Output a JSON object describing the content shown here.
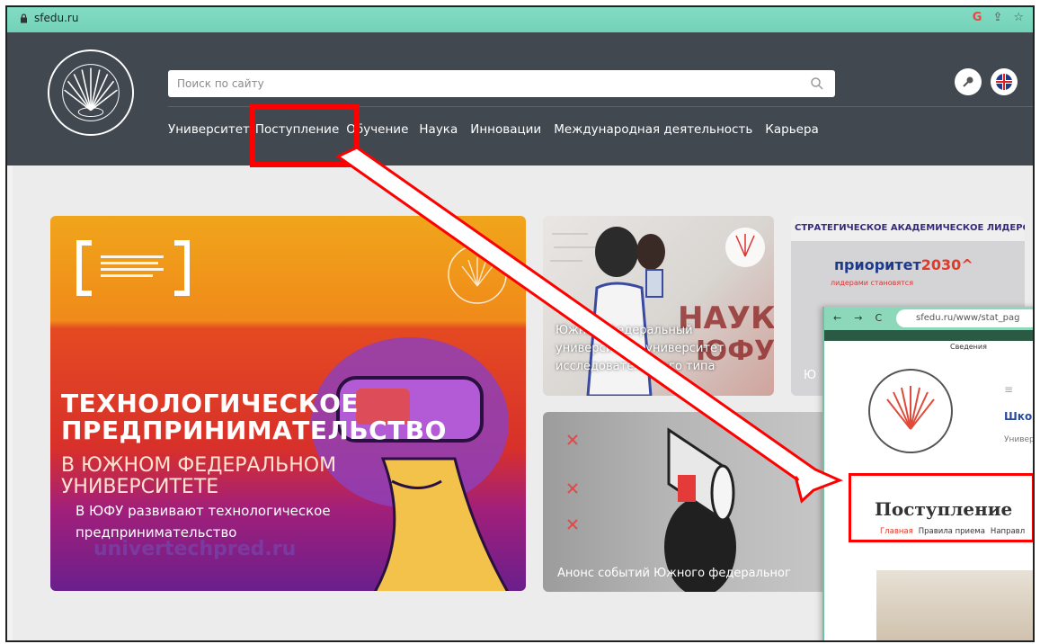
{
  "browser": {
    "url": "sfedu.ru",
    "icons": [
      "google-icon",
      "share-icon",
      "star-icon"
    ]
  },
  "header": {
    "search_placeholder": "Поиск по сайту",
    "nav": [
      "Университет",
      "Поступление",
      "Обучение",
      "Наука",
      "Инновации",
      "Международная деятельность",
      "Карьера"
    ]
  },
  "cards": {
    "big": {
      "headline1": "ТЕХНОЛОГИЧЕСКОЕ",
      "headline2": "ПРЕДПРИНИМАТЕЛЬСТВО",
      "sub1": "В ЮЖНОМ ФЕДЕРАЛЬНОМ",
      "sub2": "УНИВЕРСИТЕТЕ",
      "caption1": "В ЮФУ развивают технологическое",
      "caption2": "предпринимательство",
      "domain": "univertechpred.ru"
    },
    "science": {
      "line1": "Южный федеральный",
      "line2": "университет - университет",
      "line3": "исследовательского типа"
    },
    "priority": {
      "banner": "СТРАТЕГИЧЕСКОЕ АКАДЕМИЧЕСКОЕ ЛИДЕРСТВО",
      "logo_a": "приоритет",
      "logo_b": "2030^",
      "tagline": "лидерами становятся",
      "caption": "Ю"
    },
    "events": {
      "caption": "Анонс событий Южного федеральног"
    }
  },
  "popup": {
    "url": "sfedu.ru/www/stat_pag",
    "info": "Сведения",
    "school": "Школьн",
    "univ": "Универси",
    "title": "Поступление",
    "breadcrumb_home": "Главная",
    "breadcrumb_rules": "Правила приема",
    "breadcrumb_dir": "Направл"
  },
  "colors": {
    "header_bg": "#424850",
    "address_bar": "#7bd7bd",
    "annotation": "#ff0000"
  }
}
